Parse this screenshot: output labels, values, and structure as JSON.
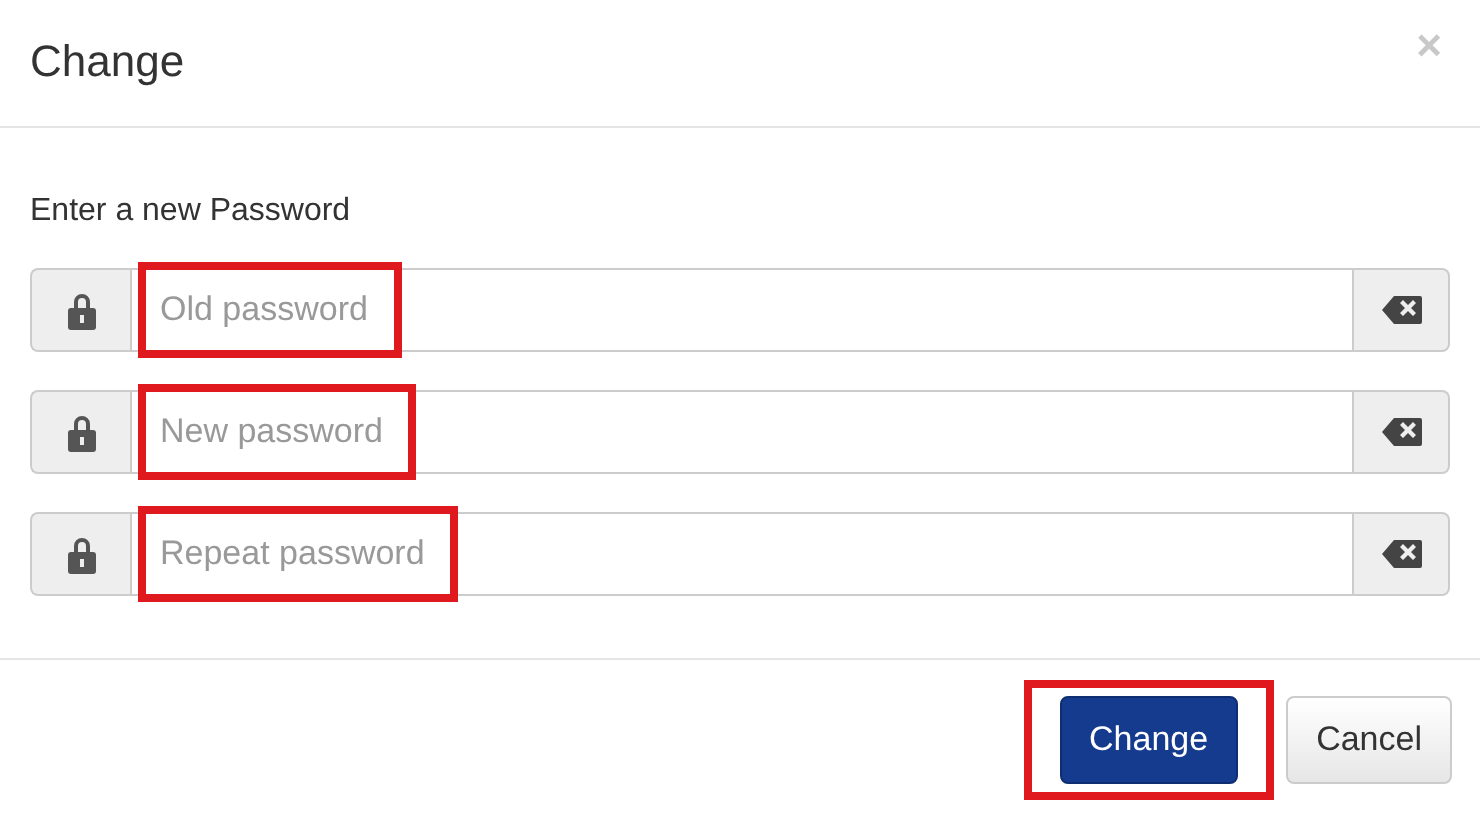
{
  "dialog": {
    "title": "Change",
    "close": "×"
  },
  "prompt": "Enter a new Password",
  "fields": [
    {
      "placeholder": "Old password",
      "highlighted": true
    },
    {
      "placeholder": "New password",
      "highlighted": true
    },
    {
      "placeholder": "Repeat password",
      "highlighted": true
    }
  ],
  "buttons": [
    {
      "label": "Change",
      "kind": "primary",
      "highlighted": true
    },
    {
      "label": "Cancel",
      "kind": "secondary",
      "highlighted": false
    }
  ]
}
